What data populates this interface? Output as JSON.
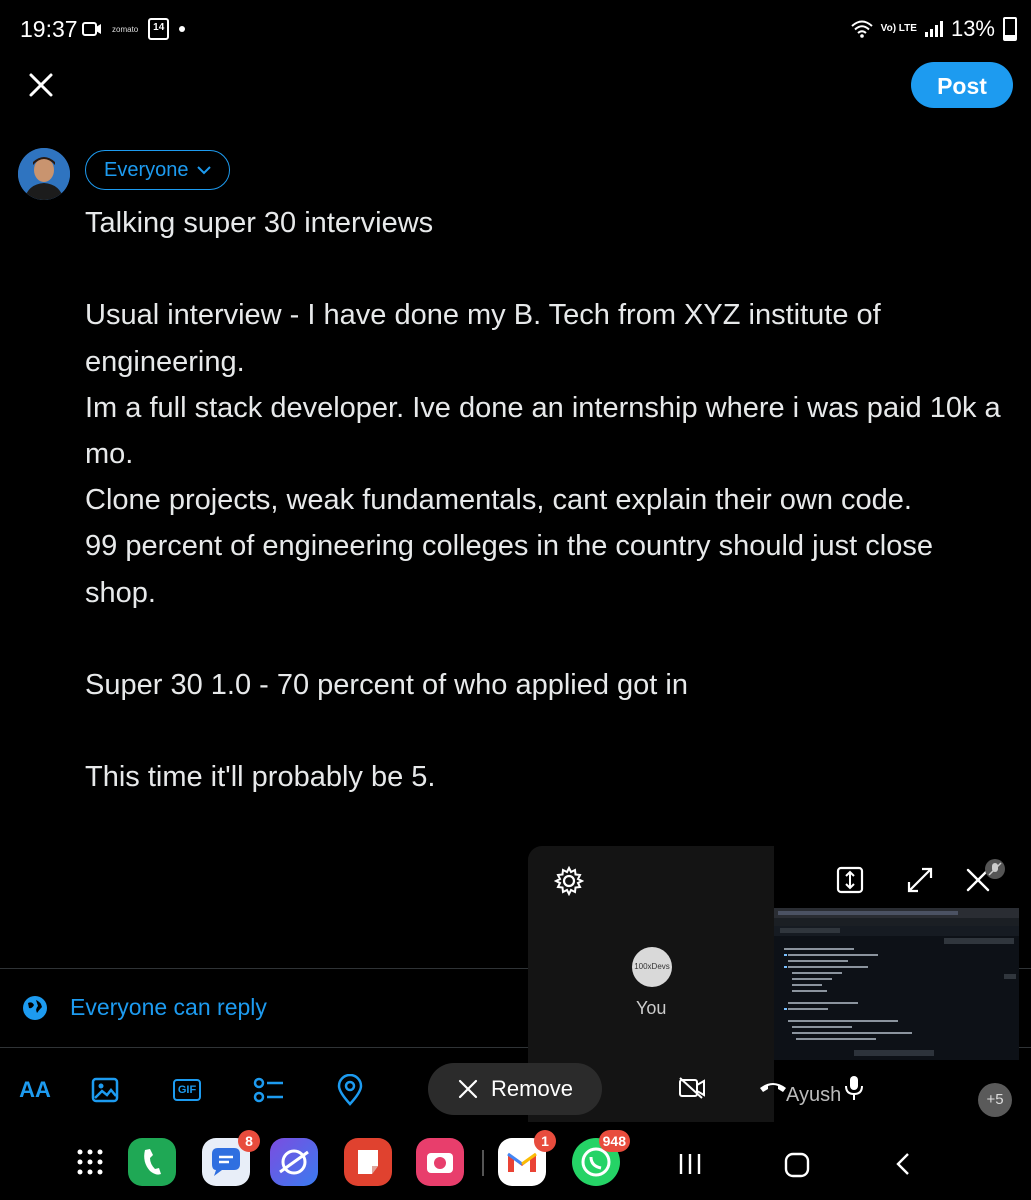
{
  "status_bar": {
    "time": "19:37",
    "brand_text": "zomato",
    "calendar_day": "14",
    "network": "Vo) LTE",
    "battery": "13%"
  },
  "header": {
    "close_icon": "close-icon",
    "post_label": "Post"
  },
  "compose": {
    "audience_label": "Everyone",
    "text": "Talking super 30 interviews\n\nUsual interview - I have done my B. Tech from XYZ institute of engineering.\nIm a full stack developer. Ive done an internship where i was paid 10k a mo.\nClone projects, weak fundamentals, cant explain their own code.\n99 percent of engineering colleges in the country should just close shop.\n\nSuper 30 1.0 - 70 percent of who applied got in\n\nThis time it'll probably be 5.",
    "reply_setting": "Everyone can reply"
  },
  "toolbar": {
    "font_label": "AA",
    "gif_label": "GIF"
  },
  "call": {
    "avatar_text": "100xDevs",
    "self_label": "You",
    "remove_label": "Remove",
    "participant_label": "Ayush",
    "more_count": "+5"
  },
  "dock": {
    "messages_badge": "8",
    "gmail_badge": "1",
    "whatsapp_badge": "948"
  },
  "colors": {
    "accent": "#1d9bf0",
    "background": "#000000"
  }
}
